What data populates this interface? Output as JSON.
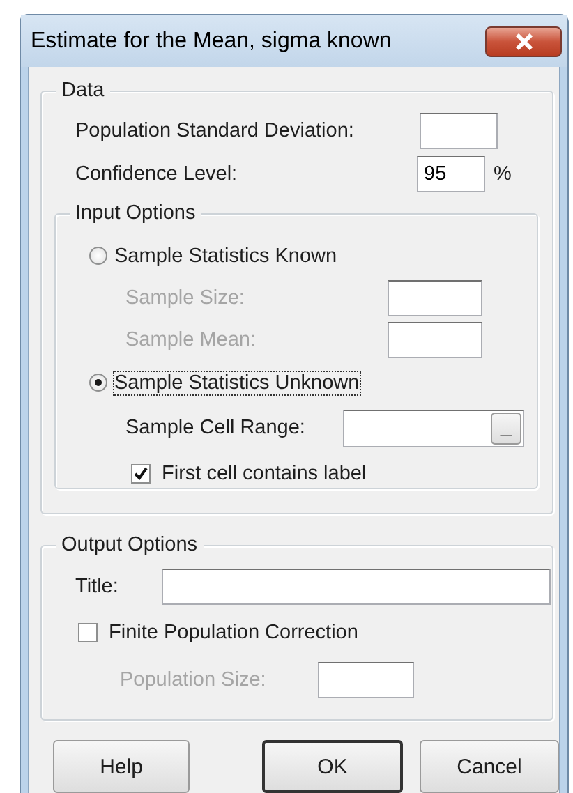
{
  "window": {
    "title": "Estimate for the Mean, sigma known"
  },
  "data": {
    "legend": "Data",
    "fields": [
      {
        "label": "Population Standard Deviation:"
      },
      {
        "label": "Confidence Level:",
        "value": "95",
        "unit": "%"
      }
    ]
  },
  "input_options": {
    "legend": "Input Options",
    "options": [
      {
        "label": "Sample Statistics Known",
        "selected": false,
        "focused": false
      },
      {
        "label": "Sample Statistics Unknown",
        "selected": true,
        "focused": true
      }
    ],
    "known_fields": [
      {
        "label": "Sample Size:",
        "disabled": true
      },
      {
        "label": "Sample Mean:",
        "disabled": true
      }
    ],
    "cell_range": {
      "label": "Sample Cell Range:",
      "button": "_"
    },
    "first_cell_label": {
      "label": "First cell contains label",
      "checked": true
    }
  },
  "output_options": {
    "legend": "Output Options",
    "title_field": {
      "label": "Title:"
    },
    "finite_correction": {
      "label": "Finite Population Correction",
      "checked": false
    },
    "population_size": {
      "label": "Population Size:",
      "disabled": true
    }
  },
  "buttons": [
    {
      "label": "Help",
      "default": false
    },
    {
      "label": "OK",
      "default": true
    },
    {
      "label": "Cancel",
      "default": false
    }
  ]
}
